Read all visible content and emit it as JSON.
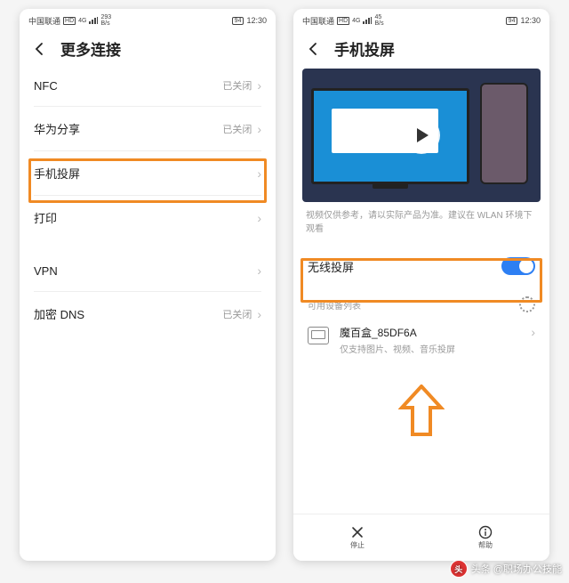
{
  "status": {
    "carrier": "中国联通",
    "net_badge": "HD",
    "net_type": "4G",
    "signal_icon": "signal-icon",
    "speed1": "293",
    "speed2": "45",
    "speed_unit": "B/s",
    "battery": "94",
    "time": "12:30"
  },
  "left": {
    "title": "更多连接",
    "rows": [
      {
        "label": "NFC",
        "value": "已关闭",
        "chevron": true
      },
      {
        "label": "华为分享",
        "value": "已关闭",
        "chevron": true
      },
      {
        "label": "手机投屏",
        "value": "",
        "chevron": true,
        "highlight": true
      },
      {
        "label": "打印",
        "value": "",
        "chevron": true
      },
      {
        "label": "VPN",
        "value": "",
        "chevron": true,
        "gap_before": true
      },
      {
        "label": "加密 DNS",
        "value": "已关闭",
        "chevron": true
      }
    ]
  },
  "right": {
    "title": "手机投屏",
    "note": "视频仅供参考，请以实际产品为准。建议在 WLAN 环境下观看",
    "toggle_label": "无线投屏",
    "toggle_on": true,
    "section_label": "可用设备列表",
    "device": {
      "name": "魔百盒_85DF6A",
      "sub": "仅支持图片、视频、音乐投屏"
    },
    "bottom": {
      "stop": "停止",
      "help": "帮助"
    }
  },
  "watermark": "头条 @职场办公技能",
  "colors": {
    "highlight": "#f08a24",
    "accent": "#2d7ff3"
  }
}
